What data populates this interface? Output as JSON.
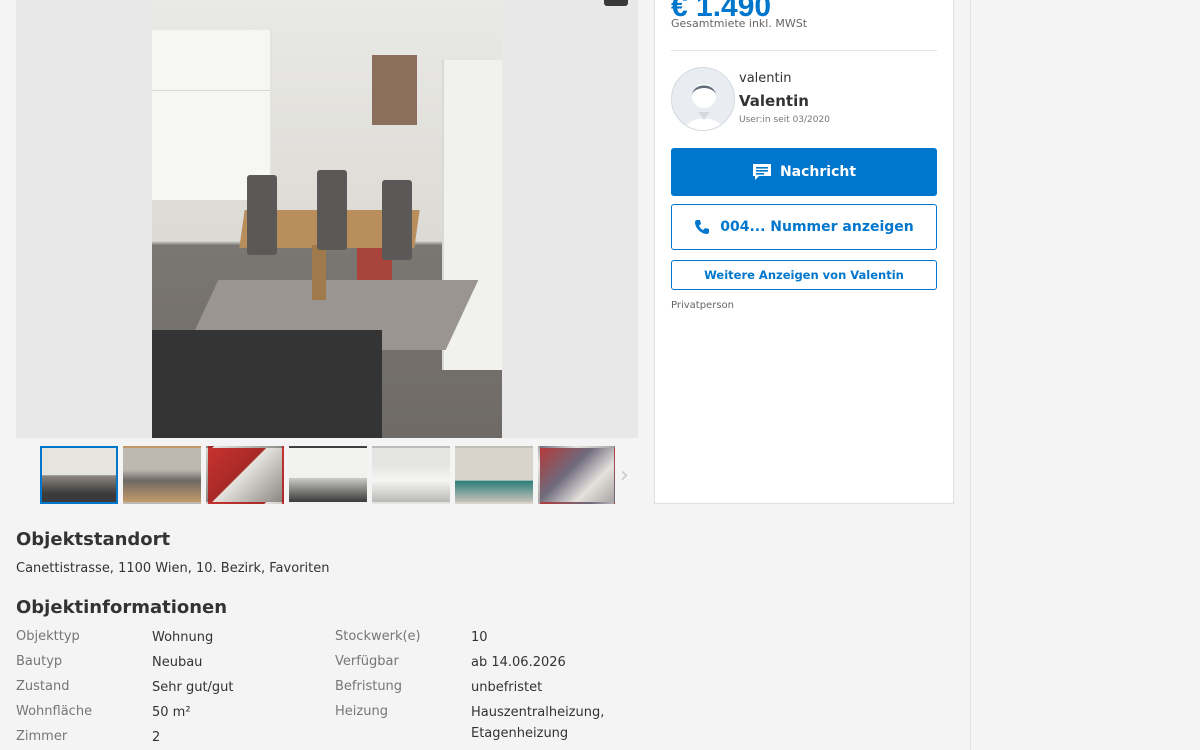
{
  "price": {
    "amount": "€ 1.490",
    "note": "Gesamtmiete inkl. MWSt"
  },
  "seller": {
    "handle": "valentin",
    "name": "Valentin",
    "member_since": "User:in seit 03/2020",
    "type": "Privatperson"
  },
  "actions": {
    "message_label": "Nachricht",
    "phone_label": "004... Nummer anzeigen",
    "more_ads_label": "Weitere Anzeigen von Valentin"
  },
  "location": {
    "title": "Objektstandort",
    "address": "Canettistrasse, 1100 Wien, 10. Bezirk, Favoriten"
  },
  "info": {
    "title": "Objektinformationen",
    "left": [
      {
        "label": "Objekttyp",
        "value": "Wohnung"
      },
      {
        "label": "Bautyp",
        "value": "Neubau"
      },
      {
        "label": "Zustand",
        "value": "Sehr gut/gut"
      },
      {
        "label": "Wohnfläche",
        "value": "50 m²"
      },
      {
        "label": "Zimmer",
        "value": "2"
      }
    ],
    "right": [
      {
        "label": "Stockwerk(e)",
        "value": "10"
      },
      {
        "label": "Verfügbar",
        "value": "ab 14.06.2026"
      },
      {
        "label": "Befristung",
        "value": "unbefristet"
      },
      {
        "label": "Heizung",
        "value": "Hauszentralheizung,\nEtagenheizung"
      }
    ]
  },
  "icons": {
    "message": "chat-bubble-icon",
    "phone": "phone-icon",
    "next": "chevron-right-icon",
    "camera": "camera-icon"
  },
  "colors": {
    "accent": "#0077cc",
    "label": "#767676"
  }
}
